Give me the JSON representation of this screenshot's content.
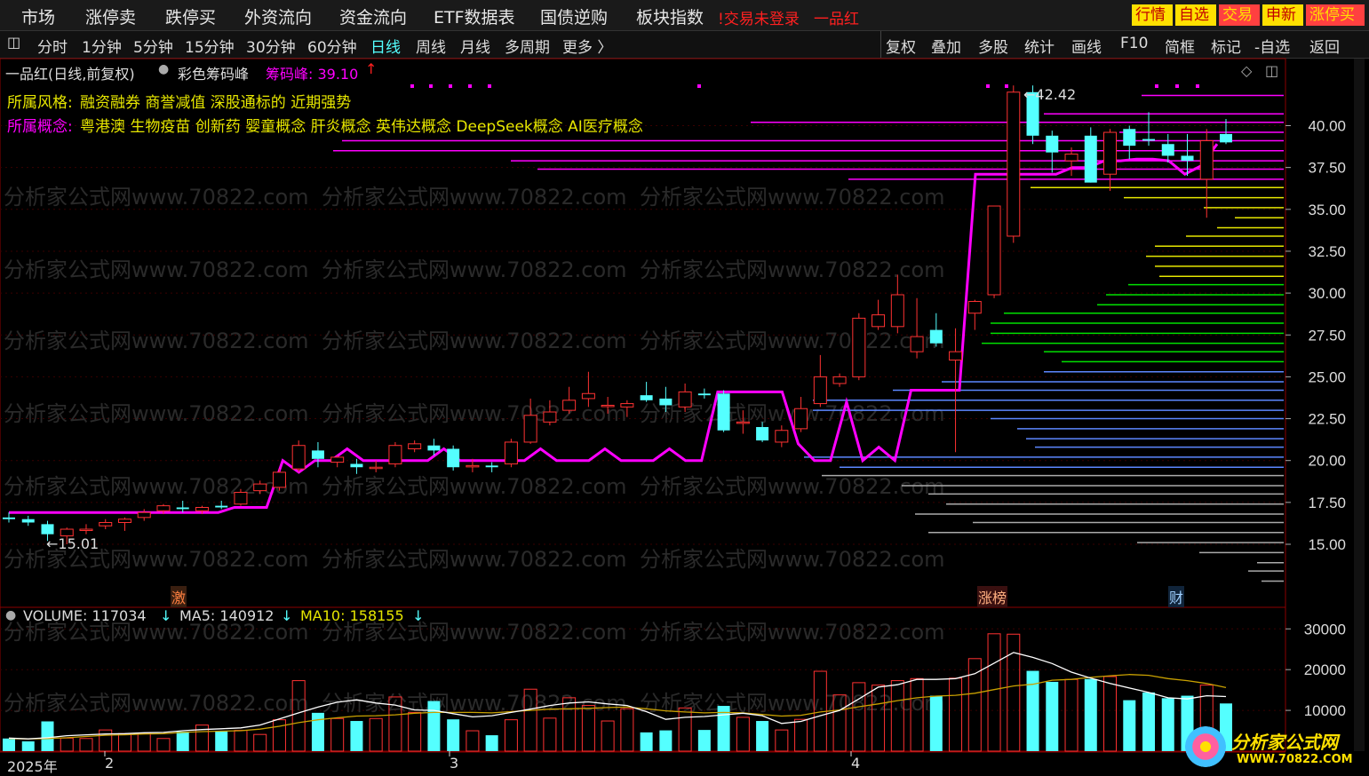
{
  "menu": {
    "items": [
      "市场",
      "涨停卖",
      "跌停买",
      "外资流向",
      "资金流向",
      "ETF数据表",
      "国债逆购",
      "板块指数"
    ],
    "warning": "!交易未登录",
    "stock_name": "一品红",
    "right_buttons": [
      {
        "label": "行情",
        "bg": "#ffe000",
        "fg": "#c00000"
      },
      {
        "label": "自选",
        "bg": "#ffe000",
        "fg": "#c00000"
      },
      {
        "label": "交易",
        "bg": "#ff4040",
        "fg": "#ffe000"
      },
      {
        "label": "申新",
        "bg": "#ffe000",
        "fg": "#c00000"
      },
      {
        "label": "涨停买",
        "bg": "#ff4040",
        "fg": "#ffe000"
      }
    ]
  },
  "periods": [
    "分时",
    "1分钟",
    "5分钟",
    "15分钟",
    "30分钟",
    "60分钟",
    "日线",
    "周线",
    "月线",
    "多周期",
    "更多 〉"
  ],
  "active_period": "日线",
  "tools": [
    "复权",
    "叠加",
    "多股",
    "统计",
    "画线",
    "F10",
    "简框",
    "标记",
    "-自选",
    "返回"
  ],
  "info": {
    "title": "一品红(日线,前复权)",
    "indicator": "彩色筹码峰",
    "peak_label": "筹码峰: 39.10",
    "peak_arrow": "↑",
    "style_label": "所属风格:",
    "style_value": "融资融券 商誉减值 深股通标的 近期强势",
    "concept_label": "所属概念:",
    "concept_value": "粤港澳 生物疫苗 创新药 婴童概念 肝炎概念 英伟达概念 DeepSeek概念 AI医疗概念"
  },
  "watermark": "分析家公式网www.70822.com",
  "markers": {
    "high": "42.42",
    "low": "15.01",
    "ji": "激",
    "zhangbang": "涨榜",
    "cai": "财"
  },
  "volume_header": {
    "vol_label": "VOLUME: 117034",
    "vol_arrow": "↓",
    "ma5_label": "MA5: 140912",
    "ma5_arrow": "↓",
    "ma10_label": "MA10: 158155",
    "ma10_arrow": "↓"
  },
  "date_labels": [
    "2025年",
    "2",
    "3",
    "4"
  ],
  "logo": {
    "title": "分析家公式网",
    "url": "WWW.70822.COM"
  },
  "colors": {
    "up": "#ff3232",
    "down": "#54ffff",
    "magenta": "#ff00ff",
    "yellow": "#e6e600",
    "green": "#00e000",
    "blue": "#5c87ff",
    "gray": "#aaaaaa",
    "white": "#ffffff"
  },
  "chart_data": {
    "type": "candlestick",
    "price_axis": {
      "ticks": [
        "40.00",
        "37.50",
        "35.00",
        "32.50",
        "30.00",
        "27.50",
        "25.00",
        "22.50",
        "20.00",
        "17.50",
        "15.00"
      ],
      "range": [
        13.5,
        43.5
      ]
    },
    "volume_axis": {
      "ticks": [
        "30000",
        "20000",
        "10000"
      ],
      "range": [
        0,
        30500
      ]
    },
    "candles": [
      {
        "o": 16.6,
        "h": 16.9,
        "l": 16.3,
        "c": 16.5
      },
      {
        "o": 16.5,
        "h": 16.7,
        "l": 16.1,
        "c": 16.3
      },
      {
        "o": 16.2,
        "h": 16.4,
        "l": 15.2,
        "c": 15.6
      },
      {
        "o": 15.5,
        "h": 16.0,
        "l": 15.0,
        "c": 15.9
      },
      {
        "o": 15.9,
        "h": 16.2,
        "l": 15.6,
        "c": 15.9
      },
      {
        "o": 16.1,
        "h": 16.5,
        "l": 15.9,
        "c": 16.3
      },
      {
        "o": 16.3,
        "h": 16.6,
        "l": 15.8,
        "c": 16.5
      },
      {
        "o": 16.6,
        "h": 17.1,
        "l": 16.4,
        "c": 16.9
      },
      {
        "o": 17.0,
        "h": 17.4,
        "l": 16.8,
        "c": 17.3
      },
      {
        "o": 17.2,
        "h": 17.6,
        "l": 16.9,
        "c": 17.1
      },
      {
        "o": 17.0,
        "h": 17.3,
        "l": 16.8,
        "c": 17.2
      },
      {
        "o": 17.3,
        "h": 17.6,
        "l": 17.1,
        "c": 17.2
      },
      {
        "o": 17.4,
        "h": 18.3,
        "l": 17.3,
        "c": 18.1
      },
      {
        "o": 18.2,
        "h": 18.8,
        "l": 18.0,
        "c": 18.6
      },
      {
        "o": 18.4,
        "h": 19.5,
        "l": 18.2,
        "c": 19.3
      },
      {
        "o": 19.5,
        "h": 21.2,
        "l": 19.3,
        "c": 20.9
      },
      {
        "o": 20.6,
        "h": 21.1,
        "l": 19.6,
        "c": 20.1
      },
      {
        "o": 19.9,
        "h": 20.3,
        "l": 19.6,
        "c": 20.2
      },
      {
        "o": 19.8,
        "h": 20.1,
        "l": 19.2,
        "c": 19.6
      },
      {
        "o": 19.6,
        "h": 20.0,
        "l": 19.3,
        "c": 19.6
      },
      {
        "o": 19.8,
        "h": 21.1,
        "l": 19.6,
        "c": 20.9
      },
      {
        "o": 20.7,
        "h": 21.2,
        "l": 20.5,
        "c": 21.0
      },
      {
        "o": 20.9,
        "h": 21.3,
        "l": 20.3,
        "c": 20.6
      },
      {
        "o": 20.7,
        "h": 20.9,
        "l": 19.4,
        "c": 19.6
      },
      {
        "o": 19.7,
        "h": 20.1,
        "l": 19.3,
        "c": 19.7
      },
      {
        "o": 19.7,
        "h": 19.9,
        "l": 19.3,
        "c": 19.6
      },
      {
        "o": 19.8,
        "h": 21.3,
        "l": 19.6,
        "c": 21.1
      },
      {
        "o": 21.1,
        "h": 23.7,
        "l": 21.0,
        "c": 22.7
      },
      {
        "o": 22.3,
        "h": 23.6,
        "l": 22.1,
        "c": 22.9
      },
      {
        "o": 23.0,
        "h": 24.4,
        "l": 22.8,
        "c": 23.6
      },
      {
        "o": 23.7,
        "h": 25.3,
        "l": 23.2,
        "c": 24.0
      },
      {
        "o": 23.3,
        "h": 23.8,
        "l": 22.8,
        "c": 23.3
      },
      {
        "o": 23.2,
        "h": 23.6,
        "l": 22.6,
        "c": 23.4
      },
      {
        "o": 23.9,
        "h": 24.7,
        "l": 23.5,
        "c": 23.6
      },
      {
        "o": 23.7,
        "h": 24.4,
        "l": 22.9,
        "c": 23.3
      },
      {
        "o": 23.2,
        "h": 24.6,
        "l": 22.9,
        "c": 24.1
      },
      {
        "o": 24.0,
        "h": 24.3,
        "l": 23.7,
        "c": 23.9
      },
      {
        "o": 24.0,
        "h": 24.2,
        "l": 21.7,
        "c": 21.8
      },
      {
        "o": 22.3,
        "h": 23.0,
        "l": 21.6,
        "c": 22.3
      },
      {
        "o": 22.0,
        "h": 22.3,
        "l": 21.1,
        "c": 21.2
      },
      {
        "o": 21.1,
        "h": 22.1,
        "l": 20.8,
        "c": 21.8
      },
      {
        "o": 21.9,
        "h": 23.8,
        "l": 21.7,
        "c": 23.1
      },
      {
        "o": 23.4,
        "h": 26.3,
        "l": 23.2,
        "c": 25.0
      },
      {
        "o": 24.6,
        "h": 25.2,
        "l": 24.4,
        "c": 25.0
      },
      {
        "o": 25.0,
        "h": 28.8,
        "l": 24.8,
        "c": 28.5
      },
      {
        "o": 28.0,
        "h": 29.6,
        "l": 27.8,
        "c": 28.7
      },
      {
        "o": 28.0,
        "h": 31.1,
        "l": 27.6,
        "c": 29.9
      },
      {
        "o": 26.5,
        "h": 29.7,
        "l": 26.1,
        "c": 27.4
      },
      {
        "o": 27.8,
        "h": 28.8,
        "l": 26.8,
        "c": 27.0
      },
      {
        "o": 26.0,
        "h": 27.9,
        "l": 20.5,
        "c": 26.5
      },
      {
        "o": 28.8,
        "h": 29.6,
        "l": 27.8,
        "c": 29.5
      },
      {
        "o": 29.9,
        "h": 35.2,
        "l": 29.7,
        "c": 35.2
      },
      {
        "o": 33.4,
        "h": 42.4,
        "l": 33.0,
        "c": 42.0
      },
      {
        "o": 42.0,
        "h": 42.4,
        "l": 38.9,
        "c": 39.4
      },
      {
        "o": 39.4,
        "h": 39.7,
        "l": 37.2,
        "c": 38.4
      },
      {
        "o": 37.9,
        "h": 38.7,
        "l": 37.0,
        "c": 38.3
      },
      {
        "o": 39.4,
        "h": 39.9,
        "l": 36.6,
        "c": 36.6
      },
      {
        "o": 37.1,
        "h": 39.8,
        "l": 36.1,
        "c": 39.6
      },
      {
        "o": 39.8,
        "h": 40.0,
        "l": 38.0,
        "c": 38.8
      },
      {
        "o": 39.2,
        "h": 40.8,
        "l": 38.8,
        "c": 39.1
      },
      {
        "o": 38.9,
        "h": 39.5,
        "l": 37.8,
        "c": 38.2
      },
      {
        "o": 38.2,
        "h": 39.5,
        "l": 37.0,
        "c": 37.9
      },
      {
        "o": 36.8,
        "h": 39.8,
        "l": 34.5,
        "c": 39.1
      },
      {
        "o": 39.5,
        "h": 40.4,
        "l": 38.9,
        "c": 39.0
      }
    ],
    "volumes": [
      3100,
      2400,
      7300,
      3200,
      3100,
      5200,
      4300,
      4400,
      3100,
      4800,
      6400,
      4800,
      5100,
      4100,
      7700,
      17300,
      9400,
      8000,
      7400,
      8000,
      13300,
      9500,
      12300,
      7800,
      5000,
      3900,
      7700,
      15200,
      8100,
      13100,
      11200,
      7400,
      10400,
      4600,
      5100,
      10600,
      5200,
      11100,
      8300,
      7400,
      5200,
      7800,
      19600,
      13800,
      16800,
      16200,
      17300,
      17800,
      13600,
      17900,
      22700,
      28800,
      28700,
      19700,
      17000,
      17600,
      17700,
      18300,
      12500,
      14400,
      13000,
      13600,
      16200,
      11700
    ],
    "ma5_volume": [
      3200,
      3000,
      3300,
      3800,
      4000,
      4200,
      4300,
      4500,
      4600,
      5000,
      5300,
      5500,
      5700,
      6400,
      7900,
      9400,
      10800,
      12000,
      12600,
      11800,
      11300,
      10100,
      10000,
      9200,
      8400,
      8700,
      9500,
      10300,
      11200,
      11800,
      12100,
      11600,
      11200,
      9700,
      7800,
      8300,
      8500,
      8900,
      9300,
      8700,
      6800,
      7300,
      8700,
      10000,
      12800,
      15700,
      16300,
      17600,
      17600,
      17800,
      19000,
      21600,
      24200,
      23000,
      21500,
      19400,
      17900,
      16600,
      15500,
      14400,
      13100,
      12800,
      13600,
      13400
    ],
    "ma10_volume": [
      3100,
      3000,
      3100,
      3300,
      3600,
      3900,
      4000,
      4200,
      4300,
      4600,
      4800,
      4900,
      5000,
      5400,
      6100,
      7000,
      7700,
      8200,
      8600,
      8700,
      8900,
      9300,
      9500,
      9500,
      9500,
      9400,
      9700,
      10000,
      10300,
      10400,
      10500,
      10700,
      10800,
      10400,
      9900,
      9600,
      9400,
      9500,
      9400,
      9000,
      8600,
      8800,
      9600,
      10100,
      10900,
      11600,
      12400,
      13100,
      13500,
      13700,
      14200,
      15100,
      16000,
      16400,
      17400,
      17600,
      18100,
      18500,
      18800,
      18600,
      17800,
      17300,
      16600,
      15600
    ],
    "cost_line": [
      16.9,
      16.9,
      16.9,
      16.9,
      16.9,
      16.9,
      16.9,
      16.9,
      16.9,
      16.9,
      16.9,
      16.9,
      16.9,
      16.9,
      17.2,
      17.2,
      17.2,
      20.0,
      19.3,
      20.0,
      20.0,
      20.7,
      20.0,
      20.0,
      20.0,
      20.0,
      20.0,
      20.7,
      20.0,
      20.0,
      20.0,
      20.0,
      20.0,
      20.7,
      20.0,
      20.0,
      20.0,
      20.7,
      20.0,
      20.0,
      20.0,
      20.7,
      20.0,
      20.0,
      24.1,
      24.1,
      24.1,
      24.1,
      24.1,
      21.0,
      20.0,
      20.0,
      23.5,
      20.0,
      20.8,
      20.0,
      24.2,
      24.2,
      24.2,
      24.2,
      37.1,
      37.1,
      37.1,
      37.1,
      37.1,
      37.1,
      37.5,
      37.5,
      37.9,
      37.9,
      38.0,
      38.0,
      37.9,
      37.1,
      37.6,
      38.9
    ],
    "chip_peak": 39.1,
    "chips": [
      {
        "p": 41.8,
        "len": 160,
        "c": "magenta"
      },
      {
        "p": 40.7,
        "len": 270,
        "c": "magenta"
      },
      {
        "p": 40.2,
        "len": 600,
        "c": "magenta"
      },
      {
        "p": 39.6,
        "len": 185,
        "c": "magenta"
      },
      {
        "p": 39.1,
        "len": 1060,
        "c": "magenta"
      },
      {
        "p": 38.5,
        "len": 1070,
        "c": "magenta"
      },
      {
        "p": 37.9,
        "len": 870,
        "c": "magenta"
      },
      {
        "p": 37.4,
        "len": 840,
        "c": "magenta"
      },
      {
        "p": 36.8,
        "len": 490,
        "c": "magenta"
      },
      {
        "p": 36.3,
        "len": 285,
        "c": "yellow"
      },
      {
        "p": 35.7,
        "len": 180,
        "c": "yellow"
      },
      {
        "p": 35.1,
        "len": 90,
        "c": "yellow"
      },
      {
        "p": 34.5,
        "len": 55,
        "c": "yellow"
      },
      {
        "p": 33.9,
        "len": 75,
        "c": "yellow"
      },
      {
        "p": 33.4,
        "len": 110,
        "c": "yellow"
      },
      {
        "p": 32.8,
        "len": 145,
        "c": "yellow"
      },
      {
        "p": 32.2,
        "len": 155,
        "c": "yellow"
      },
      {
        "p": 31.6,
        "len": 145,
        "c": "yellow"
      },
      {
        "p": 31.0,
        "len": 140,
        "c": "yellow"
      },
      {
        "p": 30.5,
        "len": 175,
        "c": "green"
      },
      {
        "p": 29.9,
        "len": 200,
        "c": "green"
      },
      {
        "p": 29.3,
        "len": 210,
        "c": "green"
      },
      {
        "p": 28.8,
        "len": 315,
        "c": "green"
      },
      {
        "p": 28.2,
        "len": 330,
        "c": "green"
      },
      {
        "p": 27.6,
        "len": 330,
        "c": "green"
      },
      {
        "p": 27.0,
        "len": 340,
        "c": "green"
      },
      {
        "p": 26.5,
        "len": 270,
        "c": "green"
      },
      {
        "p": 25.9,
        "len": 250,
        "c": "green"
      },
      {
        "p": 25.3,
        "len": 270,
        "c": "blue"
      },
      {
        "p": 24.7,
        "len": 385,
        "c": "blue"
      },
      {
        "p": 24.2,
        "len": 440,
        "c": "blue"
      },
      {
        "p": 23.6,
        "len": 530,
        "c": "blue"
      },
      {
        "p": 23.0,
        "len": 530,
        "c": "blue"
      },
      {
        "p": 22.5,
        "len": 330,
        "c": "blue"
      },
      {
        "p": 21.9,
        "len": 300,
        "c": "blue"
      },
      {
        "p": 21.3,
        "len": 290,
        "c": "blue"
      },
      {
        "p": 20.8,
        "len": 280,
        "c": "blue"
      },
      {
        "p": 20.2,
        "len": 540,
        "c": "blue"
      },
      {
        "p": 19.6,
        "len": 500,
        "c": "blue"
      },
      {
        "p": 19.1,
        "len": 520,
        "c": "gray"
      },
      {
        "p": 18.5,
        "len": 430,
        "c": "gray"
      },
      {
        "p": 18.0,
        "len": 400,
        "c": "gray"
      },
      {
        "p": 17.4,
        "len": 380,
        "c": "gray"
      },
      {
        "p": 16.8,
        "len": 415,
        "c": "gray"
      },
      {
        "p": 16.3,
        "len": 350,
        "c": "gray"
      },
      {
        "p": 15.7,
        "len": 400,
        "c": "gray"
      },
      {
        "p": 15.1,
        "len": 165,
        "c": "gray"
      },
      {
        "p": 14.5,
        "len": 95,
        "c": "gray"
      },
      {
        "p": 13.9,
        "len": 30,
        "c": "gray"
      },
      {
        "p": 13.4,
        "len": 40,
        "c": "gray"
      },
      {
        "p": 12.8,
        "len": 25,
        "c": "gray"
      }
    ]
  }
}
